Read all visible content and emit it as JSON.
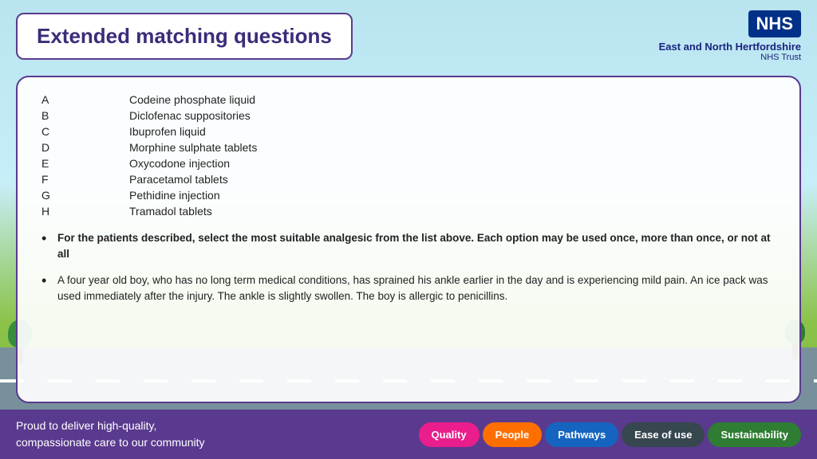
{
  "header": {
    "title": "Extended matching questions",
    "nhs_badge": "NHS",
    "trust_name": "East and North Hertfordshire",
    "trust_sub": "NHS Trust"
  },
  "options": [
    {
      "letter": "A",
      "text": "Codeine phosphate liquid"
    },
    {
      "letter": "B",
      "text": "Diclofenac suppositories"
    },
    {
      "letter": "C",
      "text": "Ibuprofen liquid"
    },
    {
      "letter": "D",
      "text": "Morphine sulphate tablets"
    },
    {
      "letter": "E",
      "text": "Oxycodone injection"
    },
    {
      "letter": "F",
      "text": "Paracetamol tablets"
    },
    {
      "letter": "G",
      "text": "Pethidine injection"
    },
    {
      "letter": "H",
      "text": "Tramadol tablets"
    }
  ],
  "instructions": [
    {
      "bold": true,
      "text": "For the patients described, select the most suitable analgesic from the list above. Each option may be used once, more than once, or not at all"
    },
    {
      "bold": false,
      "text": "A four year old boy, who has no long term medical conditions, has sprained his ankle earlier in the day and is experiencing mild pain. An ice pack was used immediately after the injury. The ankle is slightly swollen. The boy is allergic to penicillins."
    }
  ],
  "footer": {
    "text_line1": "Proud to deliver high-quality,",
    "text_line2": "compassionate care to our community",
    "badges": [
      {
        "label": "Quality",
        "class": "badge-quality"
      },
      {
        "label": "People",
        "class": "badge-people"
      },
      {
        "label": "Pathways",
        "class": "badge-pathways"
      },
      {
        "label": "Ease of use",
        "class": "badge-ease"
      },
      {
        "label": "Sustainability",
        "class": "badge-sustainability"
      }
    ]
  }
}
